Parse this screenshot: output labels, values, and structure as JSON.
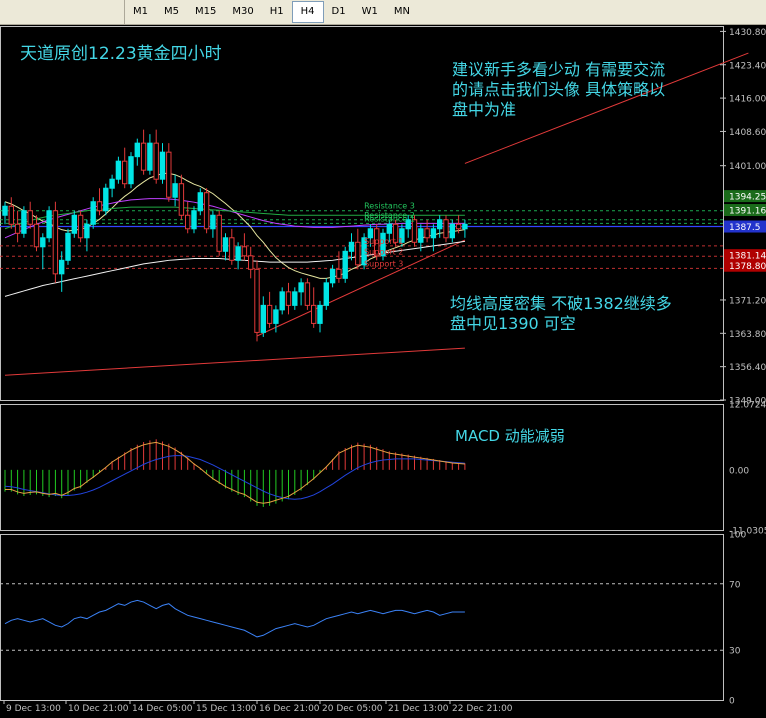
{
  "toolbar": {
    "timeframes": [
      "M1",
      "M5",
      "M15",
      "M30",
      "H1",
      "H4",
      "D1",
      "W1",
      "MN"
    ],
    "active": "H4"
  },
  "annotations": {
    "title": "天道原创12.23黄金四小时",
    "advice": [
      "建议新手多看少动  有需要交流",
      "的请点击我们头像 具体策略以",
      "盘中为准"
    ],
    "ma_comment": [
      "均线高度密集   不破1382继续多",
      "盘中见1390 可空"
    ],
    "macd_comment": "MACD 动能减弱"
  },
  "colors": {
    "bull": "#00e5e5",
    "bear": "#e23a3a",
    "annotation": "#44d7e6",
    "resistance": "#22c55e",
    "support": "#e23a3a",
    "current": "#3344ff",
    "rsi_line": "#3b82f6"
  },
  "chart_data": [
    {
      "type": "candlestick",
      "title": "",
      "y_ticks": [
        "1430.80",
        "1423.40",
        "1416.00",
        "1408.60",
        "1401.00",
        "1394.25",
        "1391.16",
        "1387.5",
        "1381.14",
        "1378.80",
        "1371.20",
        "1363.80",
        "1356.40",
        "1349.00"
      ],
      "ylim": [
        1349.0,
        1432.0
      ],
      "highlight_prices": [
        {
          "label": "1394.25",
          "value": 1394.25,
          "color": "#1a6b1a"
        },
        {
          "label": "1391.16",
          "value": 1391.16,
          "color": "#1a6b1a"
        },
        {
          "label": "1387.5",
          "value": 1387.5,
          "color": "#2233cc"
        },
        {
          "label": "1381.14",
          "value": 1381.14,
          "color": "#b00000"
        },
        {
          "label": "1378.80",
          "value": 1378.8,
          "color": "#b00000"
        }
      ],
      "levels": [
        {
          "name": "Resistance 3",
          "value": 1391.0,
          "color": "#22c55e"
        },
        {
          "name": "Resistance 2",
          "value": 1389.0,
          "color": "#22c55e"
        },
        {
          "name": "Resistance 1",
          "value": 1388.2,
          "color": "#22c55e"
        },
        {
          "name": "Support 1",
          "value": 1383.2,
          "color": "#e23a3a"
        },
        {
          "name": "Support 2",
          "value": 1380.9,
          "color": "#e23a3a"
        },
        {
          "name": "Support 3",
          "value": 1378.2,
          "color": "#e23a3a"
        }
      ],
      "current_price": 1387.5,
      "x_labels": [
        "9 Dec 13:00",
        "10 Dec 21:00",
        "14 Dec 05:00",
        "15 Dec 13:00",
        "16 Dec 21:00",
        "20 Dec 05:00",
        "21 Dec 13:00",
        "22 Dec 21:00"
      ],
      "candles": [
        [
          1390,
          1393,
          1388,
          1392
        ],
        [
          1392,
          1394,
          1387,
          1388
        ],
        [
          1388,
          1391,
          1384,
          1386
        ],
        [
          1386,
          1392,
          1385,
          1391
        ],
        [
          1391,
          1393,
          1387,
          1388
        ],
        [
          1388,
          1390,
          1382,
          1383
        ],
        [
          1383,
          1386,
          1378,
          1385
        ],
        [
          1385,
          1392,
          1384,
          1391
        ],
        [
          1391,
          1393,
          1375,
          1377
        ],
        [
          1377,
          1382,
          1373,
          1380
        ],
        [
          1380,
          1387,
          1379,
          1386
        ],
        [
          1386,
          1391,
          1385,
          1390
        ],
        [
          1390,
          1391,
          1384,
          1385
        ],
        [
          1385,
          1389,
          1382,
          1388
        ],
        [
          1388,
          1394,
          1387,
          1393
        ],
        [
          1393,
          1396,
          1390,
          1391
        ],
        [
          1391,
          1397,
          1390,
          1396
        ],
        [
          1396,
          1399,
          1394,
          1398
        ],
        [
          1398,
          1403,
          1397,
          1402
        ],
        [
          1402,
          1405,
          1396,
          1397
        ],
        [
          1397,
          1404,
          1396,
          1403
        ],
        [
          1403,
          1407,
          1401,
          1406
        ],
        [
          1406,
          1409,
          1399,
          1400
        ],
        [
          1400,
          1408,
          1399,
          1406
        ],
        [
          1406,
          1409,
          1397,
          1398
        ],
        [
          1398,
          1406,
          1397,
          1404
        ],
        [
          1404,
          1406,
          1393,
          1394
        ],
        [
          1394,
          1399,
          1392,
          1397
        ],
        [
          1397,
          1399,
          1389,
          1390
        ],
        [
          1390,
          1393,
          1386,
          1387
        ],
        [
          1387,
          1392,
          1386,
          1391
        ],
        [
          1391,
          1396,
          1390,
          1395
        ],
        [
          1395,
          1396,
          1386,
          1387
        ],
        [
          1387,
          1391,
          1385,
          1390
        ],
        [
          1390,
          1391,
          1381,
          1382
        ],
        [
          1382,
          1386,
          1380,
          1385
        ],
        [
          1385,
          1387,
          1379,
          1380
        ],
        [
          1380,
          1384,
          1378,
          1383
        ],
        [
          1383,
          1386,
          1380,
          1381
        ],
        [
          1381,
          1383,
          1376,
          1378
        ],
        [
          1378,
          1380,
          1362,
          1364
        ],
        [
          1364,
          1372,
          1363,
          1370
        ],
        [
          1370,
          1373,
          1365,
          1366
        ],
        [
          1366,
          1370,
          1364,
          1369
        ],
        [
          1369,
          1374,
          1368,
          1373
        ],
        [
          1373,
          1375,
          1368,
          1370
        ],
        [
          1370,
          1374,
          1369,
          1373
        ],
        [
          1373,
          1376,
          1370,
          1375
        ],
        [
          1375,
          1376,
          1369,
          1370
        ],
        [
          1370,
          1374,
          1365,
          1366
        ],
        [
          1366,
          1371,
          1364,
          1370
        ],
        [
          1370,
          1376,
          1369,
          1375
        ],
        [
          1375,
          1379,
          1374,
          1378
        ],
        [
          1378,
          1382,
          1375,
          1376
        ],
        [
          1376,
          1383,
          1375,
          1382
        ],
        [
          1382,
          1386,
          1380,
          1384
        ],
        [
          1384,
          1387,
          1378,
          1379
        ],
        [
          1379,
          1386,
          1378,
          1385
        ],
        [
          1385,
          1388,
          1383,
          1387
        ],
        [
          1387,
          1388,
          1380,
          1381
        ],
        [
          1381,
          1387,
          1380,
          1386
        ],
        [
          1386,
          1389,
          1384,
          1388
        ],
        [
          1388,
          1389,
          1383,
          1384
        ],
        [
          1384,
          1388,
          1383,
          1387
        ],
        [
          1387,
          1390,
          1385,
          1389
        ],
        [
          1389,
          1390,
          1383,
          1384
        ],
        [
          1384,
          1388,
          1382,
          1387
        ],
        [
          1387,
          1389,
          1384,
          1385
        ],
        [
          1385,
          1388,
          1382,
          1387
        ],
        [
          1387,
          1390,
          1385,
          1389
        ],
        [
          1389,
          1390,
          1384,
          1385
        ],
        [
          1385,
          1389,
          1384,
          1388
        ],
        [
          1388,
          1390,
          1386,
          1387
        ],
        [
          1387,
          1389,
          1385,
          1388
        ]
      ],
      "moving_averages": [
        {
          "color": "#e6e6a0",
          "values": [
            1393,
            1392.5,
            1391.8,
            1391,
            1390.3,
            1389.5,
            1388.7,
            1388.2,
            1387.4,
            1386.8,
            1386.5,
            1386.7,
            1386.9,
            1387.3,
            1388.2,
            1389.1,
            1390.3,
            1391.6,
            1393,
            1394.2,
            1395.2,
            1396.4,
            1397.4,
            1398.3,
            1398.8,
            1399.3,
            1399.3,
            1399,
            1398.4,
            1397.6,
            1396.9,
            1396.4,
            1395.6,
            1394.8,
            1393.7,
            1392.6,
            1391.4,
            1390.2,
            1388.8,
            1387.4,
            1385.5,
            1384,
            1382.2,
            1380.6,
            1379.4,
            1378.4,
            1377.7,
            1377.2,
            1376.8,
            1376.4,
            1376,
            1376,
            1376.3,
            1376.6,
            1377.2,
            1378,
            1378.6,
            1379.4,
            1380.3,
            1380.9,
            1381.6,
            1382.3,
            1382.8,
            1383.3,
            1384,
            1384.5,
            1384.9,
            1385.3,
            1385.6,
            1386,
            1386.2,
            1386.4,
            1386.6,
            1386.8
          ]
        },
        {
          "color": "#c040ff",
          "values": [
            1385,
            1385.6,
            1386.2,
            1386.8,
            1387.4,
            1388,
            1388.5,
            1389,
            1389.4,
            1389.8,
            1390.2,
            1390.6,
            1391,
            1391.4,
            1391.8,
            1392.1,
            1392.4,
            1392.7,
            1393,
            1393.2,
            1393.4,
            1393.5,
            1393.6,
            1393.7,
            1393.7,
            1393.7,
            1393.6,
            1393.5,
            1393.3,
            1393.1,
            1392.9,
            1392.6,
            1392.3,
            1392,
            1391.6,
            1391.2,
            1390.8,
            1390.4,
            1390,
            1389.6,
            1389.2,
            1388.8,
            1388.5,
            1388.2,
            1388,
            1387.8,
            1387.6,
            1387.5,
            1387.4,
            1387.3,
            1387.3,
            1387.3,
            1387.3,
            1387.4,
            1387.5,
            1387.6,
            1387.7,
            1387.8,
            1387.9,
            1388,
            1388,
            1388.1,
            1388.1,
            1388.2,
            1388.2,
            1388.2,
            1388.2,
            1388.2,
            1388.2,
            1388.2,
            1388.2,
            1388.2,
            1388.2,
            1388.2
          ]
        },
        {
          "color": "#f2f2f2",
          "values": [
            1372,
            1372.4,
            1372.8,
            1373.2,
            1373.6,
            1374,
            1374.4,
            1374.7,
            1375,
            1375.3,
            1375.6,
            1375.9,
            1376.2,
            1376.5,
            1376.8,
            1377.1,
            1377.4,
            1377.7,
            1378,
            1378.3,
            1378.6,
            1378.9,
            1379.2,
            1379.4,
            1379.6,
            1379.8,
            1380,
            1380.1,
            1380.2,
            1380.3,
            1380.4,
            1380.4,
            1380.4,
            1380.4,
            1380.4,
            1380.3,
            1380.2,
            1380.1,
            1380,
            1379.9,
            1379.8,
            1379.7,
            1379.6,
            1379.6,
            1379.6,
            1379.6,
            1379.6,
            1379.6,
            1379.6,
            1379.7,
            1379.8,
            1379.9,
            1380,
            1380.2,
            1380.4,
            1380.6,
            1380.8,
            1381,
            1381.2,
            1381.4,
            1381.6,
            1381.8,
            1382,
            1382.2,
            1382.4,
            1382.6,
            1382.8,
            1383,
            1383.2,
            1383.4,
            1383.6,
            1383.8,
            1384,
            1384.2
          ]
        },
        {
          "color": "#22aa44",
          "values": [
            1387,
            1387.5,
            1388,
            1388.4,
            1388.8,
            1389.2,
            1389.5,
            1389.8,
            1390,
            1390.2,
            1390.4,
            1390.6,
            1390.8,
            1391,
            1391.2,
            1391.3,
            1391.4,
            1391.5,
            1391.6,
            1391.7,
            1391.8,
            1391.8,
            1391.8,
            1391.8,
            1391.8,
            1391.8,
            1391.8,
            1391.8,
            1391.7,
            1391.6,
            1391.5,
            1391.4,
            1391.3,
            1391.2,
            1391.1,
            1391,
            1390.9,
            1390.8,
            1390.7,
            1390.6,
            1390.5,
            1390.4,
            1390.3,
            1390.2,
            1390.1,
            1390,
            1390,
            1390,
            1390,
            1390,
            1390,
            1390,
            1390,
            1390,
            1390,
            1390,
            1390,
            1390,
            1390,
            1390,
            1390,
            1390,
            1390,
            1390,
            1390,
            1390,
            1390,
            1390,
            1390,
            1390,
            1390,
            1390,
            1390,
            1390
          ]
        }
      ],
      "trend_lines": [
        {
          "from": [
            40,
            1363.2
          ],
          "to": [
            73,
            1384.5
          ],
          "color": "#e23a3a"
        },
        {
          "from": [
            0,
            1354.5
          ],
          "to": [
            73,
            1360.5
          ],
          "color": "#e23a3a"
        },
        {
          "from": [
            73,
            1401.5
          ],
          "to": [
            118,
            1426.0
          ],
          "color": "#e23a3a"
        }
      ]
    },
    {
      "type": "bar",
      "title": "",
      "y_ticks": [
        "12.0724",
        "0.00",
        "-11.0305"
      ],
      "ylim": [
        -11.0305,
        12.0724
      ],
      "histogram": [
        -4,
        -4,
        -4.5,
        -4.8,
        -4.6,
        -4.5,
        -4.8,
        -5,
        -4.8,
        -5.2,
        -4.6,
        -3.8,
        -3.4,
        -2.4,
        -1.5,
        -0.5,
        0.5,
        1.6,
        2.4,
        3.2,
        4,
        4.6,
        5.1,
        5.4,
        5.6,
        5.2,
        4.8,
        4.1,
        3.3,
        2.3,
        1.2,
        0.3,
        -0.8,
        -1.8,
        -2.6,
        -3.4,
        -4,
        -4.6,
        -5,
        -5.8,
        -6.6,
        -6.8,
        -6.6,
        -6.2,
        -5.8,
        -5.4,
        -4.6,
        -3.8,
        -2.8,
        -1.8,
        -0.6,
        0.6,
        2,
        3.4,
        4,
        4.6,
        5,
        4.8,
        4.6,
        4.2,
        3.8,
        3.4,
        3.2,
        3,
        2.8,
        2.6,
        2.4,
        2.2,
        2,
        1.8,
        1.6,
        1.4,
        1.3,
        1.2
      ],
      "signal": [
        -3,
        -3.1,
        -3.3,
        -3.6,
        -3.8,
        -4,
        -4.2,
        -4.4,
        -4.6,
        -4.7,
        -4.7,
        -4.6,
        -4.4,
        -4.1,
        -3.7,
        -3.2,
        -2.6,
        -2,
        -1.4,
        -0.8,
        -0.2,
        0.4,
        1,
        1.5,
        1.9,
        2.2,
        2.5,
        2.6,
        2.6,
        2.5,
        2.2,
        1.9,
        1.4,
        0.9,
        0.3,
        -0.3,
        -0.9,
        -1.5,
        -2.1,
        -2.7,
        -3.3,
        -3.9,
        -4.4,
        -4.8,
        -5.1,
        -5.3,
        -5.4,
        -5.3,
        -5,
        -4.6,
        -4,
        -3.3,
        -2.6,
        -1.8,
        -1,
        -0.3,
        0.4,
        0.9,
        1.3,
        1.6,
        1.8,
        1.9,
        2,
        2,
        2,
        2,
        1.9,
        1.8,
        1.7,
        1.6,
        1.5,
        1.4,
        1.3,
        1.2
      ]
    },
    {
      "type": "line",
      "title": "",
      "y_ticks": [
        "100",
        "70",
        "30",
        "0"
      ],
      "ylim": [
        0,
        100
      ],
      "levels": [
        70,
        30
      ],
      "values": [
        46,
        48,
        49,
        48,
        47,
        48,
        49,
        47,
        45,
        44,
        46,
        49,
        50,
        49,
        51,
        53,
        54,
        56,
        58,
        57,
        59,
        60,
        59,
        57,
        55,
        57,
        58,
        55,
        53,
        51,
        50,
        49,
        48,
        47,
        46,
        45,
        44,
        43,
        42,
        40,
        38,
        39,
        41,
        43,
        44,
        45,
        46,
        45,
        44,
        45,
        47,
        49,
        50,
        51,
        52,
        53,
        52,
        53,
        54,
        53,
        52,
        53,
        54,
        54,
        53,
        52,
        53,
        54,
        53,
        51,
        52,
        53,
        53,
        53
      ]
    }
  ]
}
